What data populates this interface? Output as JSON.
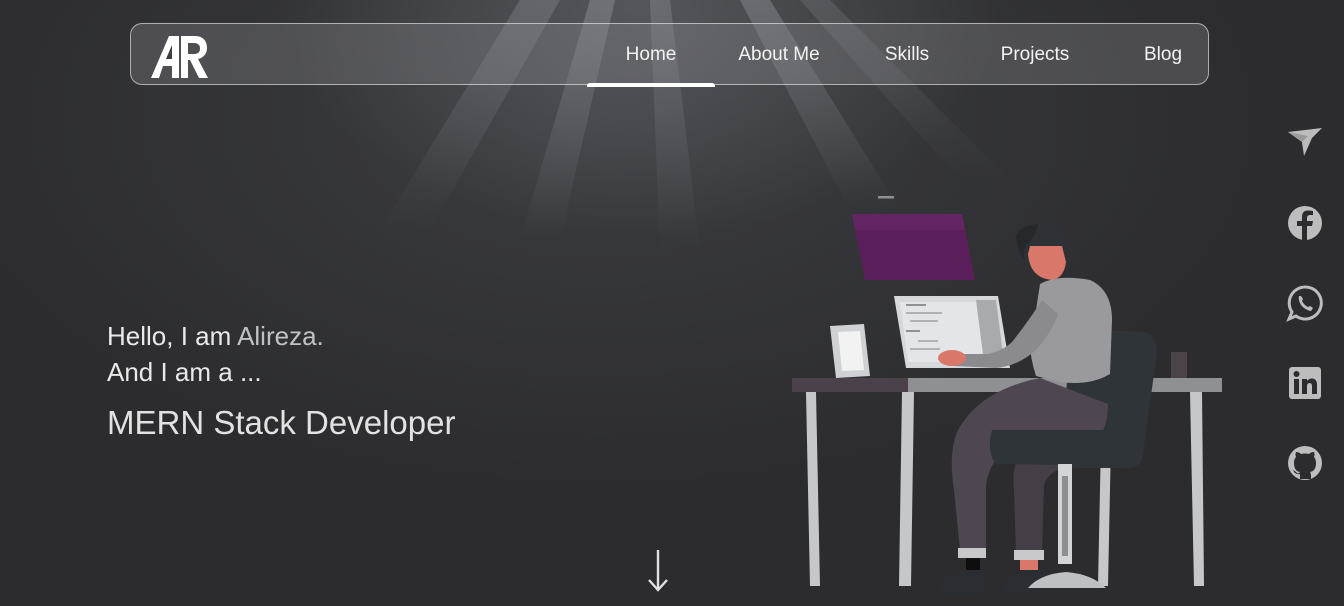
{
  "nav": {
    "logo_text": "AR",
    "items": [
      {
        "label": "Home",
        "active": true
      },
      {
        "label": "About Me",
        "active": false
      },
      {
        "label": "Skills",
        "active": false
      },
      {
        "label": "Projects",
        "active": false
      },
      {
        "label": "Blog",
        "active": false
      }
    ]
  },
  "hero": {
    "greeting_prefix": "Hello, I am ",
    "name": "Alireza.",
    "line2": "And I am a ...",
    "role": "MERN Stack Developer"
  },
  "socials": [
    {
      "icon": "bird-icon"
    },
    {
      "icon": "facebook-icon"
    },
    {
      "icon": "whatsapp-icon"
    },
    {
      "icon": "linkedin-icon"
    },
    {
      "icon": "github-icon"
    }
  ],
  "icons": {
    "scroll": "arrow-down-icon"
  },
  "colors": {
    "background": "#2c2c2e",
    "nav_text": "#f2f2f2",
    "social_icon": "#bdbdbd",
    "monitor_screen": "#5a1f5a"
  }
}
